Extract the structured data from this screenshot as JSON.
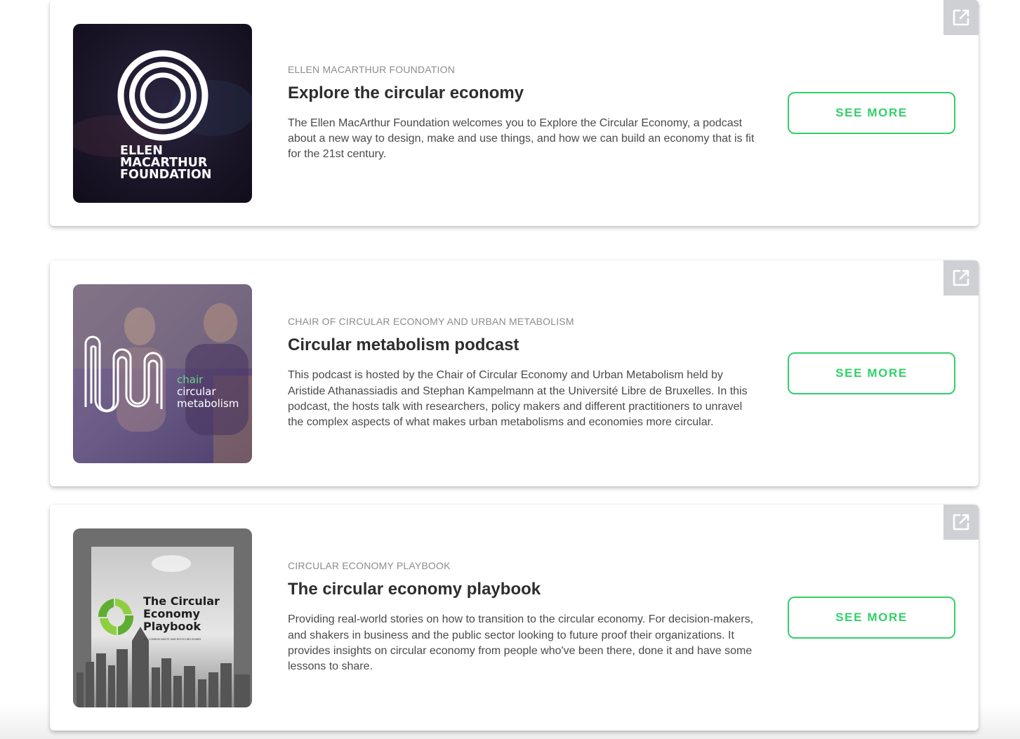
{
  "colors": {
    "accent": "#33d06a",
    "title_text": "#2d2d2d",
    "body_text": "#4a4a4a",
    "eyebrow_text": "#8c8c8c",
    "external_link_bg": "#cfd0d3"
  },
  "cards": [
    {
      "eyebrow": "CHAIR OF CIRCULAR ECONOMY AND URBAN METABOLISM",
      "title": "Circular metabolism podcast",
      "description": "This podcast is hosted by the Chair of Circular Economy and Urban Metabolism held by Aristide Athanassiadis and Stephan Kampelmann at the Université Libre de Bruxelles. In this podcast, the hosts talk with researchers, policy makers and different practitioners to unravel the complex aspects of what makes urban metabolisms and economies more circular.",
      "button_label": "SEE MORE",
      "image": {
        "logo_line1": "chair",
        "logo_line2": "circular",
        "logo_line3": "metabolism"
      },
      "icon": "external-link-icon"
    },
    {
      "eyebrow": "CIRCULAR ECONOMY PLAYBOOK",
      "title": "The circular economy playbook",
      "description": "Providing real-world stories on how to transition to the circular economy. For decision-makers, and shakers in business and the public sector looking to future proof their organizations. It provides insights on circular economy from people who've been there, done it and have some lessons to share.",
      "button_label": "SEE MORE",
      "image": {
        "line1": "The Circular",
        "line2": "Economy",
        "line3": "Playbook",
        "tagline": "THE LONDON WASTE AND RECYCLING BOARD"
      },
      "icon": "external-link-icon"
    },
    {
      "eyebrow": "ELLEN MACARTHUR FOUNDATION",
      "title": "Explore the circular economy",
      "description": "The Ellen MacArthur Foundation welcomes you to Explore the Circular Economy, a podcast about a new way to design, make and use things, and how we can build an economy that is fit for the 21st century.",
      "button_label": "SEE MORE",
      "image": {
        "line1": "ELLEN",
        "line2": "MACARTHUR",
        "line3": "FOUNDATION"
      },
      "icon": "external-link-icon"
    }
  ]
}
